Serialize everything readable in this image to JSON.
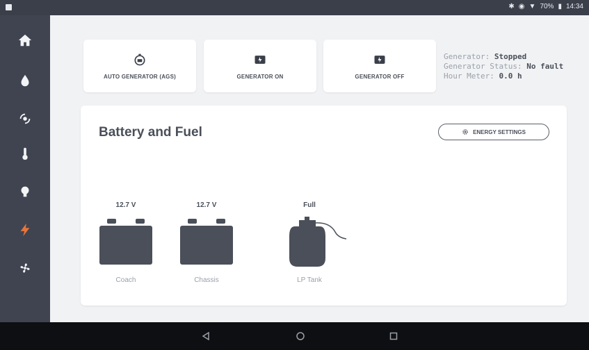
{
  "status_bar": {
    "battery": "70%",
    "time": "14:34"
  },
  "sidebar": {
    "items": [
      {
        "name": "home",
        "icon": "home-icon"
      },
      {
        "name": "water",
        "icon": "water-drop-icon"
      },
      {
        "name": "climate",
        "icon": "climate-icon"
      },
      {
        "name": "temperature",
        "icon": "thermometer-icon"
      },
      {
        "name": "lights",
        "icon": "lightbulb-icon"
      },
      {
        "name": "power",
        "icon": "lightning-icon",
        "active": true
      },
      {
        "name": "fan",
        "icon": "fan-icon"
      }
    ],
    "active_color": "#e8753a"
  },
  "generator": {
    "auto_label": "AUTO GENERATOR (AGS)",
    "on_label": "GENERATOR ON",
    "off_label": "GENERATOR OFF",
    "status_key": "Generator:",
    "status_value": "Stopped",
    "fault_key": "Generator Status:",
    "fault_value": "No fault",
    "hours_key": "Hour Meter:",
    "hours_value": "0.0 h"
  },
  "battery_fuel": {
    "title": "Battery and Fuel",
    "settings_label": "ENERGY SETTINGS",
    "coach": {
      "value": "12.7 V",
      "name": "Coach"
    },
    "chassis": {
      "value": "12.7 V",
      "name": "Chassis"
    },
    "lp_tank": {
      "value": "Full",
      "name": "LP Tank"
    }
  }
}
